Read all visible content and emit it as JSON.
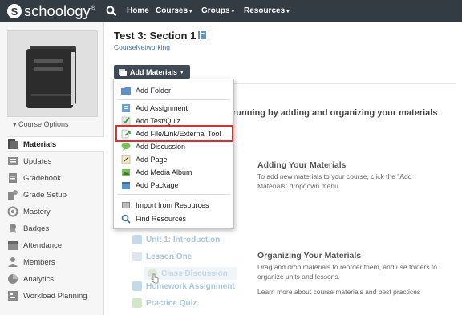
{
  "brand": {
    "logo_letter": "S",
    "name": "schoology",
    "trademark": "®"
  },
  "nav": {
    "items": [
      {
        "label": "Home",
        "caret": ""
      },
      {
        "label": "Courses",
        "caret": "▾"
      },
      {
        "label": "Groups",
        "caret": "▾"
      },
      {
        "label": "Resources",
        "caret": "▾"
      }
    ]
  },
  "sidebar": {
    "course_options": "▾  Course Options",
    "items": [
      {
        "label": "Materials",
        "icon": "materials-icon"
      },
      {
        "label": "Updates",
        "icon": "updates-icon"
      },
      {
        "label": "Gradebook",
        "icon": "gradebook-icon"
      },
      {
        "label": "Grade Setup",
        "icon": "grade-setup-icon"
      },
      {
        "label": "Mastery",
        "icon": "mastery-icon"
      },
      {
        "label": "Badges",
        "icon": "badges-icon"
      },
      {
        "label": "Attendance",
        "icon": "attendance-icon"
      },
      {
        "label": "Members",
        "icon": "members-icon"
      },
      {
        "label": "Analytics",
        "icon": "analytics-icon"
      },
      {
        "label": "Workload Planning",
        "icon": "workload-icon"
      }
    ]
  },
  "page": {
    "title": "Test 3: Section 1",
    "subtitle": "CourseNetworking",
    "add_button": "Add Materials",
    "add_caret": "▾"
  },
  "menu": {
    "items": [
      {
        "label": "Add Folder",
        "icon": "folder-icon"
      },
      {
        "label": "Add Assignment",
        "icon": "assignment-icon"
      },
      {
        "label": "Add Test/Quiz",
        "icon": "test-quiz-icon"
      },
      {
        "label": "Add File/Link/External Tool",
        "icon": "file-link-icon"
      },
      {
        "label": "Add Discussion",
        "icon": "discussion-icon"
      },
      {
        "label": "Add Page",
        "icon": "page-icon"
      },
      {
        "label": "Add Media Album",
        "icon": "media-album-icon"
      },
      {
        "label": "Add Package",
        "icon": "package-icon"
      },
      {
        "label": "Import from Resources",
        "icon": "import-icon"
      },
      {
        "label": "Find Resources",
        "icon": "find-icon"
      }
    ]
  },
  "help": {
    "getting_started": "running by adding and organizing your materials",
    "adding_title": "Adding Your Materials",
    "adding_text": "To add new materials to your course, click the \"Add Materials\" dropdown menu.",
    "organizing_title": "Organizing Your Materials",
    "organizing_text": "Drag and drop materials to reorder them, and use folders to organize units and lessons.",
    "learn_more": "Learn more about course materials and best practices"
  },
  "ghost_tree": {
    "unit": "Unit 1: Introduction",
    "lesson": "Lesson One",
    "discussion": "Class Discussion",
    "homework": "Homework Assignment",
    "quiz": "Practice Quiz"
  },
  "colors": {
    "topbar": "#333b43",
    "accent": "#3d6fa3",
    "highlight": "#d8322b"
  }
}
